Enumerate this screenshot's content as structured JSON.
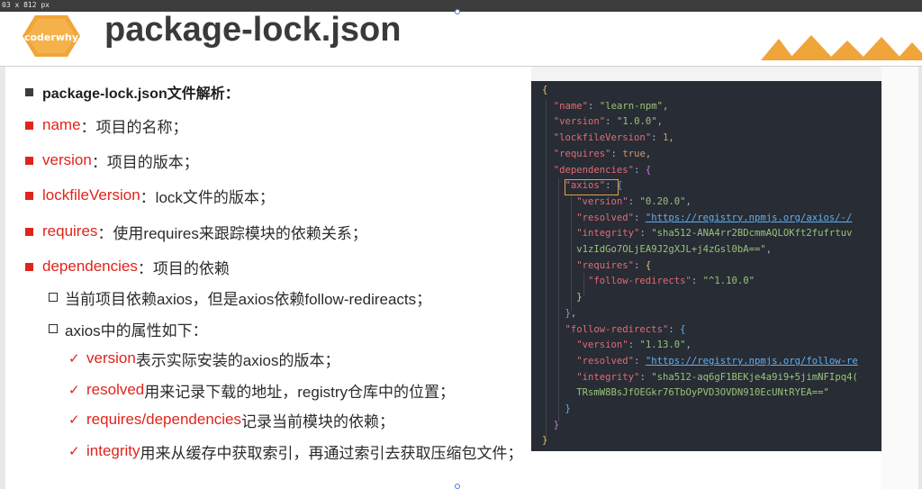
{
  "topbar": {
    "dims": "03 x 812  px"
  },
  "header": {
    "logo_text": "coderwhy",
    "title": "package-lock.json",
    "logo_color": "#f0a53a",
    "mountain_color": "#f0a53a"
  },
  "content": {
    "heading": "package-lock.json文件解析：",
    "items": [
      {
        "key": "name",
        "desc": "：项目的名称；"
      },
      {
        "key": "version",
        "desc": "：项目的版本；"
      },
      {
        "key": "lockfileVersion",
        "desc": "：lock文件的版本；"
      },
      {
        "key": "requires",
        "desc": "：使用requires来跟踪模块的依赖关系；"
      },
      {
        "key": "dependencies",
        "desc": "：项目的依赖"
      }
    ],
    "sub_items": [
      "当前项目依赖axios，但是axios依赖follow-redireacts；",
      "axios中的属性如下："
    ],
    "check_items": [
      {
        "key": "version",
        "desc": "表示实际安装的axios的版本；"
      },
      {
        "key": "resolved",
        "desc": "用来记录下载的地址，registry仓库中的位置；"
      },
      {
        "key": "requires/dependencies",
        "desc": "记录当前模块的依赖；"
      },
      {
        "key": "integrity",
        "desc": "用来从缓存中获取索引，再通过索引去获取压缩包文件；"
      }
    ]
  },
  "code": {
    "name_val": "\"learn-npm\"",
    "version_val": "\"1.0.0\"",
    "lockfile_val": "1",
    "requires_val": "true",
    "axios_version": "\"0.20.0\"",
    "axios_resolved": "\"https://registry.npmjs.org/axios/-/",
    "axios_integrity_1": "\"sha512-ANA4rr2BDcmmAQLOKft2fufrtuv",
    "axios_integrity_2": "v1zIdGo7OLjEA9J2gXJL+j4zGsl0bA==\"",
    "follow_req_val": "\"^1.10.0\"",
    "fr_version": "\"1.13.0\"",
    "fr_resolved": "\"https://registry.npmjs.org/follow-re",
    "fr_integrity_1": "\"sha512-aq6gF1BEKje4a9i9+5jimNFIpq4(",
    "fr_integrity_2": "TRsmW8BsJfOEGkr76TbOyPVD3OVDN910EcUNtRYEA==\""
  }
}
